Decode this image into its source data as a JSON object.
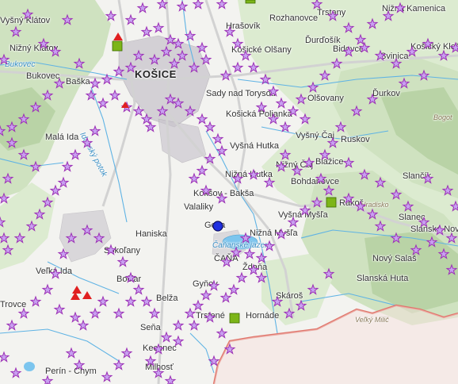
{
  "map": {
    "colors": {
      "background": "#f3f3f0",
      "forest": "#cfe2c0",
      "forest_dark": "#b9d3a6",
      "water": "#5fb3e4",
      "road": "#d8d8d8",
      "urban": "#c9c5cd",
      "border": "#e0766c",
      "star_fill": "#c8a0f0",
      "star_stroke": "#9b2fb5",
      "square_fill": "#7cb518",
      "triangle_fill": "#e02020",
      "circle_fill": "#2030e0"
    },
    "labels": {
      "city": "KOŠICE",
      "vysny_klatov": "Vyšný Klátov",
      "nizny_klatov": "Nižný Klátov",
      "bukovec_water": "Bukovec",
      "bukovec": "Bukovec",
      "baska": "Baška",
      "hrasovik": "Hrašovík",
      "rozhanovce": "Rozhanovce",
      "trstany": "Trstany",
      "nizna_kamenica": "Nižná Kamenica",
      "durdosik": "Ďurďošík",
      "kosicke_olsany": "Košické Olšany",
      "bidovce": "Bidovce",
      "svinica": "Svinica",
      "kosicky_klecenov": "Košický Klečenov",
      "sady_nad_torysou": "Sady nad Torysou",
      "olsovany": "Olšovany",
      "durkov": "Ďurkov",
      "kosicka_polianka": "Košická Polianka",
      "bogota": "Bogot",
      "mala_ida": "Malá Ida",
      "idansky_potok": "Idanský potok",
      "vysna_hutka": "Vyšná Hutka",
      "vysny_caj": "Vyšný Čaj",
      "ruskov": "Ruskov",
      "nizna_hutka": "Nižná Hutka",
      "nizny_caj": "Nižný Čaj",
      "blazice": "Blažice",
      "bohdanovce": "Bohdanovce",
      "slanec": "Slančík",
      "koksov_baksa": "Kokšov - Bakša",
      "rakos": "Rákoš",
      "hradisko": "Hradisko",
      "valaliky": "Valaliky",
      "vysna_mysla": "Vyšná Myšľa",
      "slanec2": "Slanec",
      "slanske_nove": "Slanské Nové",
      "geca": "Geča",
      "haniska": "Haniska",
      "nizna_mysla": "Nižná Myšľa",
      "caransky_jazero": "Čaňanské jazero",
      "sokolany": "Sokoľany",
      "cana": "ČAŇA",
      "velka_ida": "Veľká Ida",
      "zdana": "Ždaňa",
      "novy_salas": "Nový Salaš",
      "bociar": "Bočiar",
      "slanska_huta": "Slanská Huta",
      "gynov": "Gyňov",
      "belza": "Belža",
      "skaros": "Skároš",
      "trovce": "Trovce",
      "trstene": "Trstené",
      "hornade": "Hornáde",
      "vysny_milic": "Veľký Milič",
      "sena": "Seňa",
      "kechnec": "Kechnec",
      "perin_chym": "Perín - Chym",
      "milhost": "Milhosť"
    }
  }
}
